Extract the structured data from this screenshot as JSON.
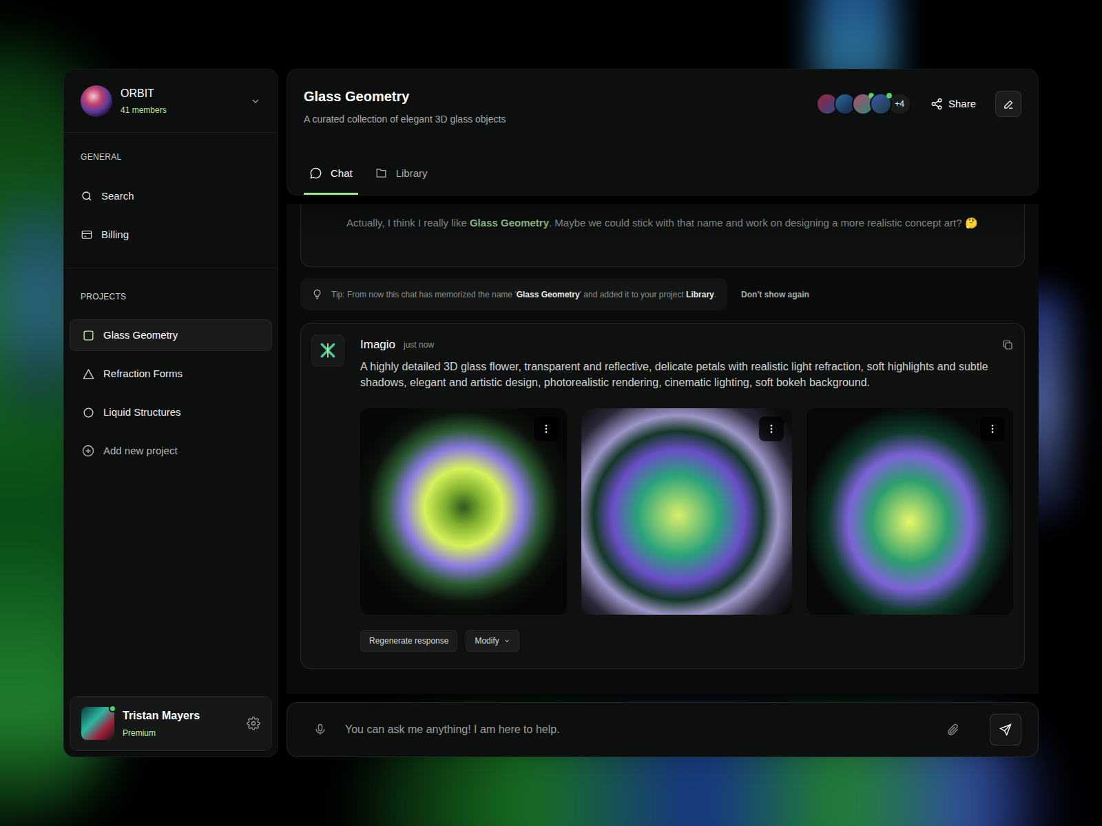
{
  "workspace": {
    "name": "ORBIT",
    "members": "41 members"
  },
  "sidebar": {
    "general_label": "GENERAL",
    "general": [
      {
        "label": "Search",
        "kind": "search"
      },
      {
        "label": "Billing",
        "kind": "billing"
      }
    ],
    "projects_label": "PROJECTS",
    "projects": [
      {
        "label": "Glass Geometry",
        "kind": "square",
        "selected": true
      },
      {
        "label": "Refraction Forms",
        "kind": "triangle",
        "selected": false
      },
      {
        "label": "Liquid Structures",
        "kind": "circle",
        "selected": false
      }
    ],
    "add_project": "Add new project"
  },
  "user": {
    "name": "Tristan Mayers",
    "plan": "Premium",
    "online": true
  },
  "header": {
    "title": "Glass Geometry",
    "subtitle": "A curated collection of elegant 3D glass objects",
    "members": [
      {
        "online": false
      },
      {
        "online": false
      },
      {
        "online": true
      },
      {
        "online": true
      }
    ],
    "more": "+4",
    "share": "Share"
  },
  "tabs": [
    {
      "label": "Chat",
      "selected": true
    },
    {
      "label": "Library",
      "selected": false
    }
  ],
  "previous_message": {
    "segments": [
      {
        "text": "Actually, I think I really like ",
        "highlight": false
      },
      {
        "text": "Glass Geometry",
        "highlight": true
      },
      {
        "text": ". Maybe we could stick with that name and work on designing a more realistic concept art? 🤔",
        "highlight": false
      }
    ]
  },
  "tip": {
    "segments": [
      {
        "text": "Tip: From now this chat has memorized the name '",
        "bold": false
      },
      {
        "text": "Glass Geometry",
        "bold": true
      },
      {
        "text": "' and added it to your project ",
        "bold": false
      },
      {
        "text": "Library",
        "bold": true
      },
      {
        "text": ".",
        "bold": false
      }
    ],
    "dismiss": "Don't show again"
  },
  "response": {
    "author": "Imagio",
    "time": "just now",
    "text": "A highly detailed 3D glass flower, transparent and reflective, delicate petals with realistic light refraction, soft highlights and subtle shadows, elegant and artistic design, photorealistic rendering, cinematic lighting, soft bokeh background.",
    "images": [
      {
        "kind": "flower"
      },
      {
        "kind": "sphere"
      },
      {
        "kind": "pod"
      }
    ],
    "actions": [
      {
        "label": "Regenerate response",
        "kind": "button"
      },
      {
        "label": "Modify",
        "kind": "dropdown"
      }
    ]
  },
  "composer": {
    "placeholder": "You can ask me anything! I am here to help."
  }
}
